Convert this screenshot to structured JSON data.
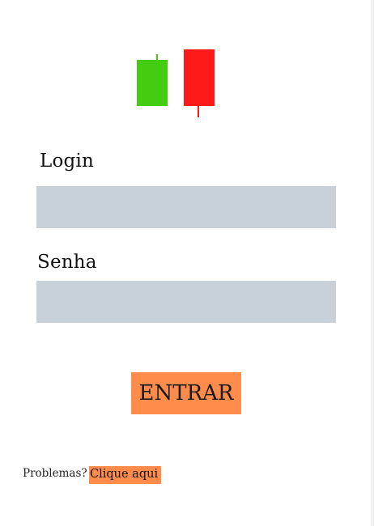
{
  "colors": {
    "background": "#ffffff",
    "input_fill": "#c8d0da",
    "accent_orange": "#ff8c4a",
    "candle_bull": "#44cc11",
    "candle_bear": "#ff1a1a"
  },
  "logo": {
    "icon": "candlestick-chart-icon"
  },
  "form": {
    "login_label": "Login",
    "login_value": "",
    "password_label": "Senha",
    "password_value": "",
    "submit_label": "ENTRAR"
  },
  "footer": {
    "problems_text": "Problemas?",
    "help_link": "Clique aqui"
  }
}
